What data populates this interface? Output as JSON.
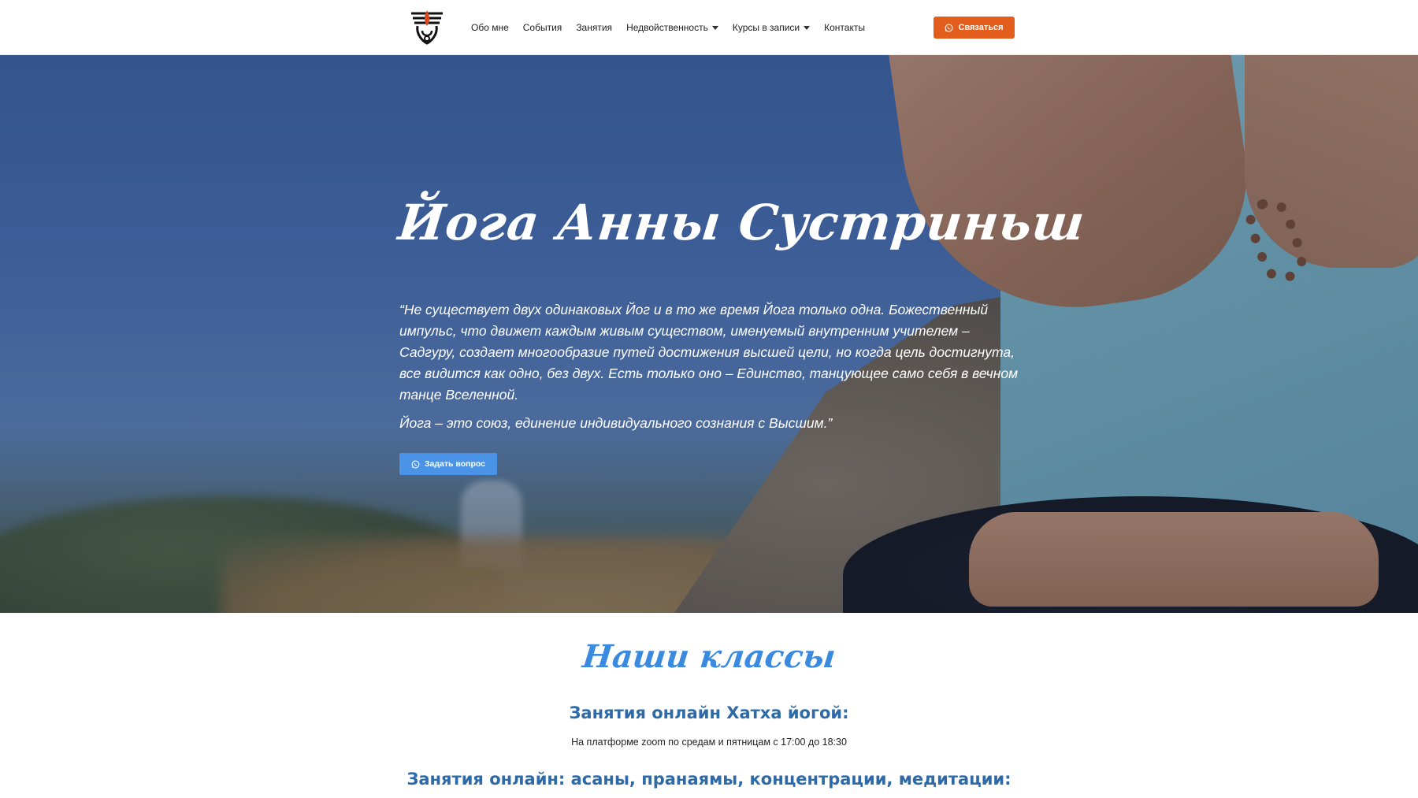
{
  "header": {
    "nav": [
      {
        "label": "Обо мне",
        "dropdown": false
      },
      {
        "label": "События",
        "dropdown": false
      },
      {
        "label": "Занятия",
        "dropdown": false
      },
      {
        "label": "Недвойственность",
        "dropdown": true
      },
      {
        "label": "Курсы в записи",
        "dropdown": true
      },
      {
        "label": "Контакты",
        "dropdown": false
      }
    ],
    "contact_button": {
      "label": "Связаться",
      "icon": "whatsapp-icon",
      "color": "#e35d1c"
    }
  },
  "hero": {
    "title": "Йога Анны Сустриньш",
    "quote_p1": "“Не существует двух одинаковых Йог и в то же время Йога только одна. Божественный импульс, что движет каждым живым существом, именуемый внутренним учителем – Садгуру, создает многообразие путей достижения высшей цели, но когда цель достигнута, все видится как одно, без двух. Есть только оно – Единство, танцующее само себя в вечном танце Вселенной.",
    "quote_p2": "Йога – это союз, единение индивидуального сознания с Высшим.”",
    "ask_button": {
      "label": "Задать вопрос",
      "icon": "whatsapp-icon",
      "color": "#4a93e6"
    }
  },
  "classes": {
    "title": "Наши классы",
    "items": [
      {
        "heading": "Занятия онлайн Хатха йогой:",
        "description": "На платформе zoom по средам и пятницам с 17:00 до 18:30"
      },
      {
        "heading": "Занятия онлайн: асаны, пранаямы, концентрации, медитации:",
        "description": ""
      }
    ]
  },
  "colors": {
    "accent_orange": "#e35d1c",
    "accent_blue": "#3a8ae0",
    "heading_blue": "#2e6aa8"
  }
}
